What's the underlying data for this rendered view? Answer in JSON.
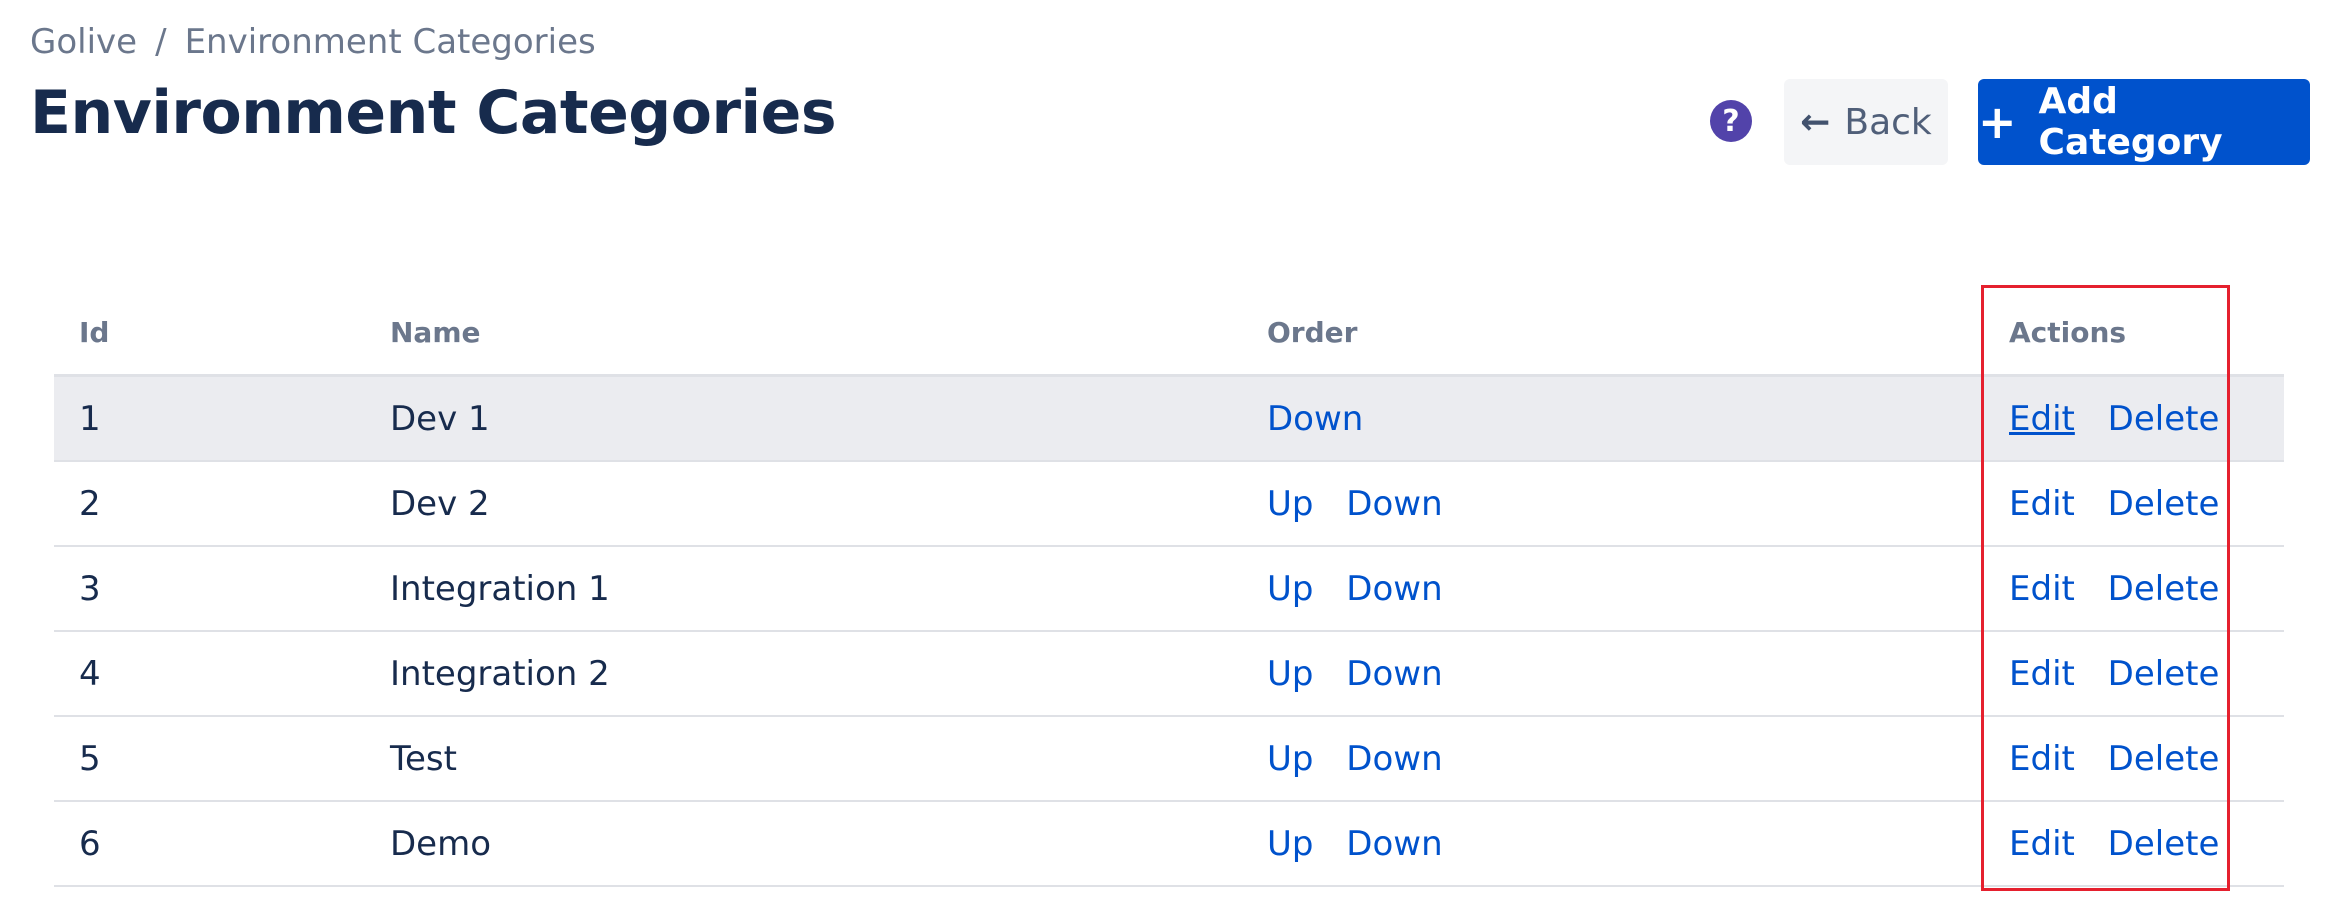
{
  "breadcrumb": {
    "items": [
      "Golive",
      "Environment Categories"
    ],
    "separator": "/"
  },
  "page": {
    "title": "Environment Categories"
  },
  "header_actions": {
    "help_icon": "question-circle-icon",
    "help_glyph": "?",
    "back_label": "Back",
    "back_icon": "arrow-left-icon",
    "back_glyph": "←",
    "add_label": "Add Category",
    "add_icon": "plus-icon",
    "add_glyph": "+"
  },
  "table": {
    "columns": [
      "Id",
      "Name",
      "Order",
      "Actions"
    ],
    "rows": [
      {
        "id": "1",
        "name": "Dev 1",
        "order": [
          "Down"
        ],
        "actions": [
          "Edit",
          "Delete"
        ]
      },
      {
        "id": "2",
        "name": "Dev 2",
        "order": [
          "Up",
          "Down"
        ],
        "actions": [
          "Edit",
          "Delete"
        ]
      },
      {
        "id": "3",
        "name": "Integration 1",
        "order": [
          "Up",
          "Down"
        ],
        "actions": [
          "Edit",
          "Delete"
        ]
      },
      {
        "id": "4",
        "name": "Integration 2",
        "order": [
          "Up",
          "Down"
        ],
        "actions": [
          "Edit",
          "Delete"
        ]
      },
      {
        "id": "5",
        "name": "Test",
        "order": [
          "Up",
          "Down"
        ],
        "actions": [
          "Edit",
          "Delete"
        ]
      },
      {
        "id": "6",
        "name": "Demo",
        "order": [
          "Up",
          "Down"
        ],
        "actions": [
          "Edit",
          "Delete"
        ]
      }
    ]
  },
  "colors": {
    "primary": "#0052cc",
    "title": "#172b4d",
    "muted": "#6b778c",
    "help": "#5243aa",
    "highlight": "#e5202e",
    "row_hover": "#ebecf0"
  }
}
